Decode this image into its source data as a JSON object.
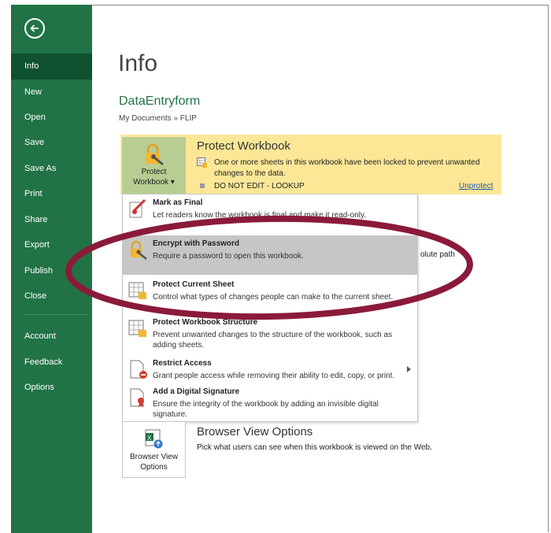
{
  "sidebar": {
    "items": [
      {
        "label": "Info",
        "active": true
      },
      {
        "label": "New"
      },
      {
        "label": "Open"
      },
      {
        "label": "Save"
      },
      {
        "label": "Save As"
      },
      {
        "label": "Print"
      },
      {
        "label": "Share"
      },
      {
        "label": "Export"
      },
      {
        "label": "Publish"
      },
      {
        "label": "Close"
      },
      {
        "label": "Account"
      },
      {
        "label": "Feedback"
      },
      {
        "label": "Options"
      }
    ]
  },
  "page": {
    "title": "Info",
    "workbook_name": "DataEntryform",
    "path": "My Documents » FLIP"
  },
  "protect": {
    "button_label_line1": "Protect",
    "button_label_line2": "Workbook ▾",
    "heading": "Protect Workbook",
    "description": "One or more sheets in this workbook have been locked to prevent unwanted changes to the data.",
    "locked_sheet": "DO NOT EDIT - LOOKUP",
    "unprotect_link": "Unprotect"
  },
  "dropdown": {
    "items": [
      {
        "title": "Mark as Final",
        "desc": "Let readers know the workbook is final and make it read-only."
      },
      {
        "title": "Encrypt with Password",
        "desc": "Require a password to open this workbook."
      },
      {
        "title": "Protect Current Sheet",
        "desc": "Control what types of changes people can make to the current sheet."
      },
      {
        "title": "Protect Workbook Structure",
        "desc": "Prevent unwanted changes to the structure of the workbook, such as adding sheets."
      },
      {
        "title": "Restrict Access",
        "desc": "Grant people access while removing their ability to edit, copy, or print."
      },
      {
        "title": "Add a Digital Signature",
        "desc": "Ensure the integrity of the workbook by adding an invisible digital signature."
      }
    ]
  },
  "browser_view": {
    "button_label_line1": "Browser View",
    "button_label_line2": "Options",
    "heading": "Browser View Options",
    "description": "Pick what users can see when this workbook is viewed on the Web."
  },
  "background_text": {
    "clipped": "olute path"
  },
  "colors": {
    "sidebar": "#217346",
    "sidebar_active": "#0f5130",
    "protect_panel": "#fce797",
    "protect_button": "#b8cd92",
    "menu_hover": "#c6c6c6",
    "annotation": "#8b1a3a"
  },
  "icons": {
    "back": "back-arrow-icon",
    "protect": "lock-icon",
    "browser_view": "excel-globe-icon"
  }
}
